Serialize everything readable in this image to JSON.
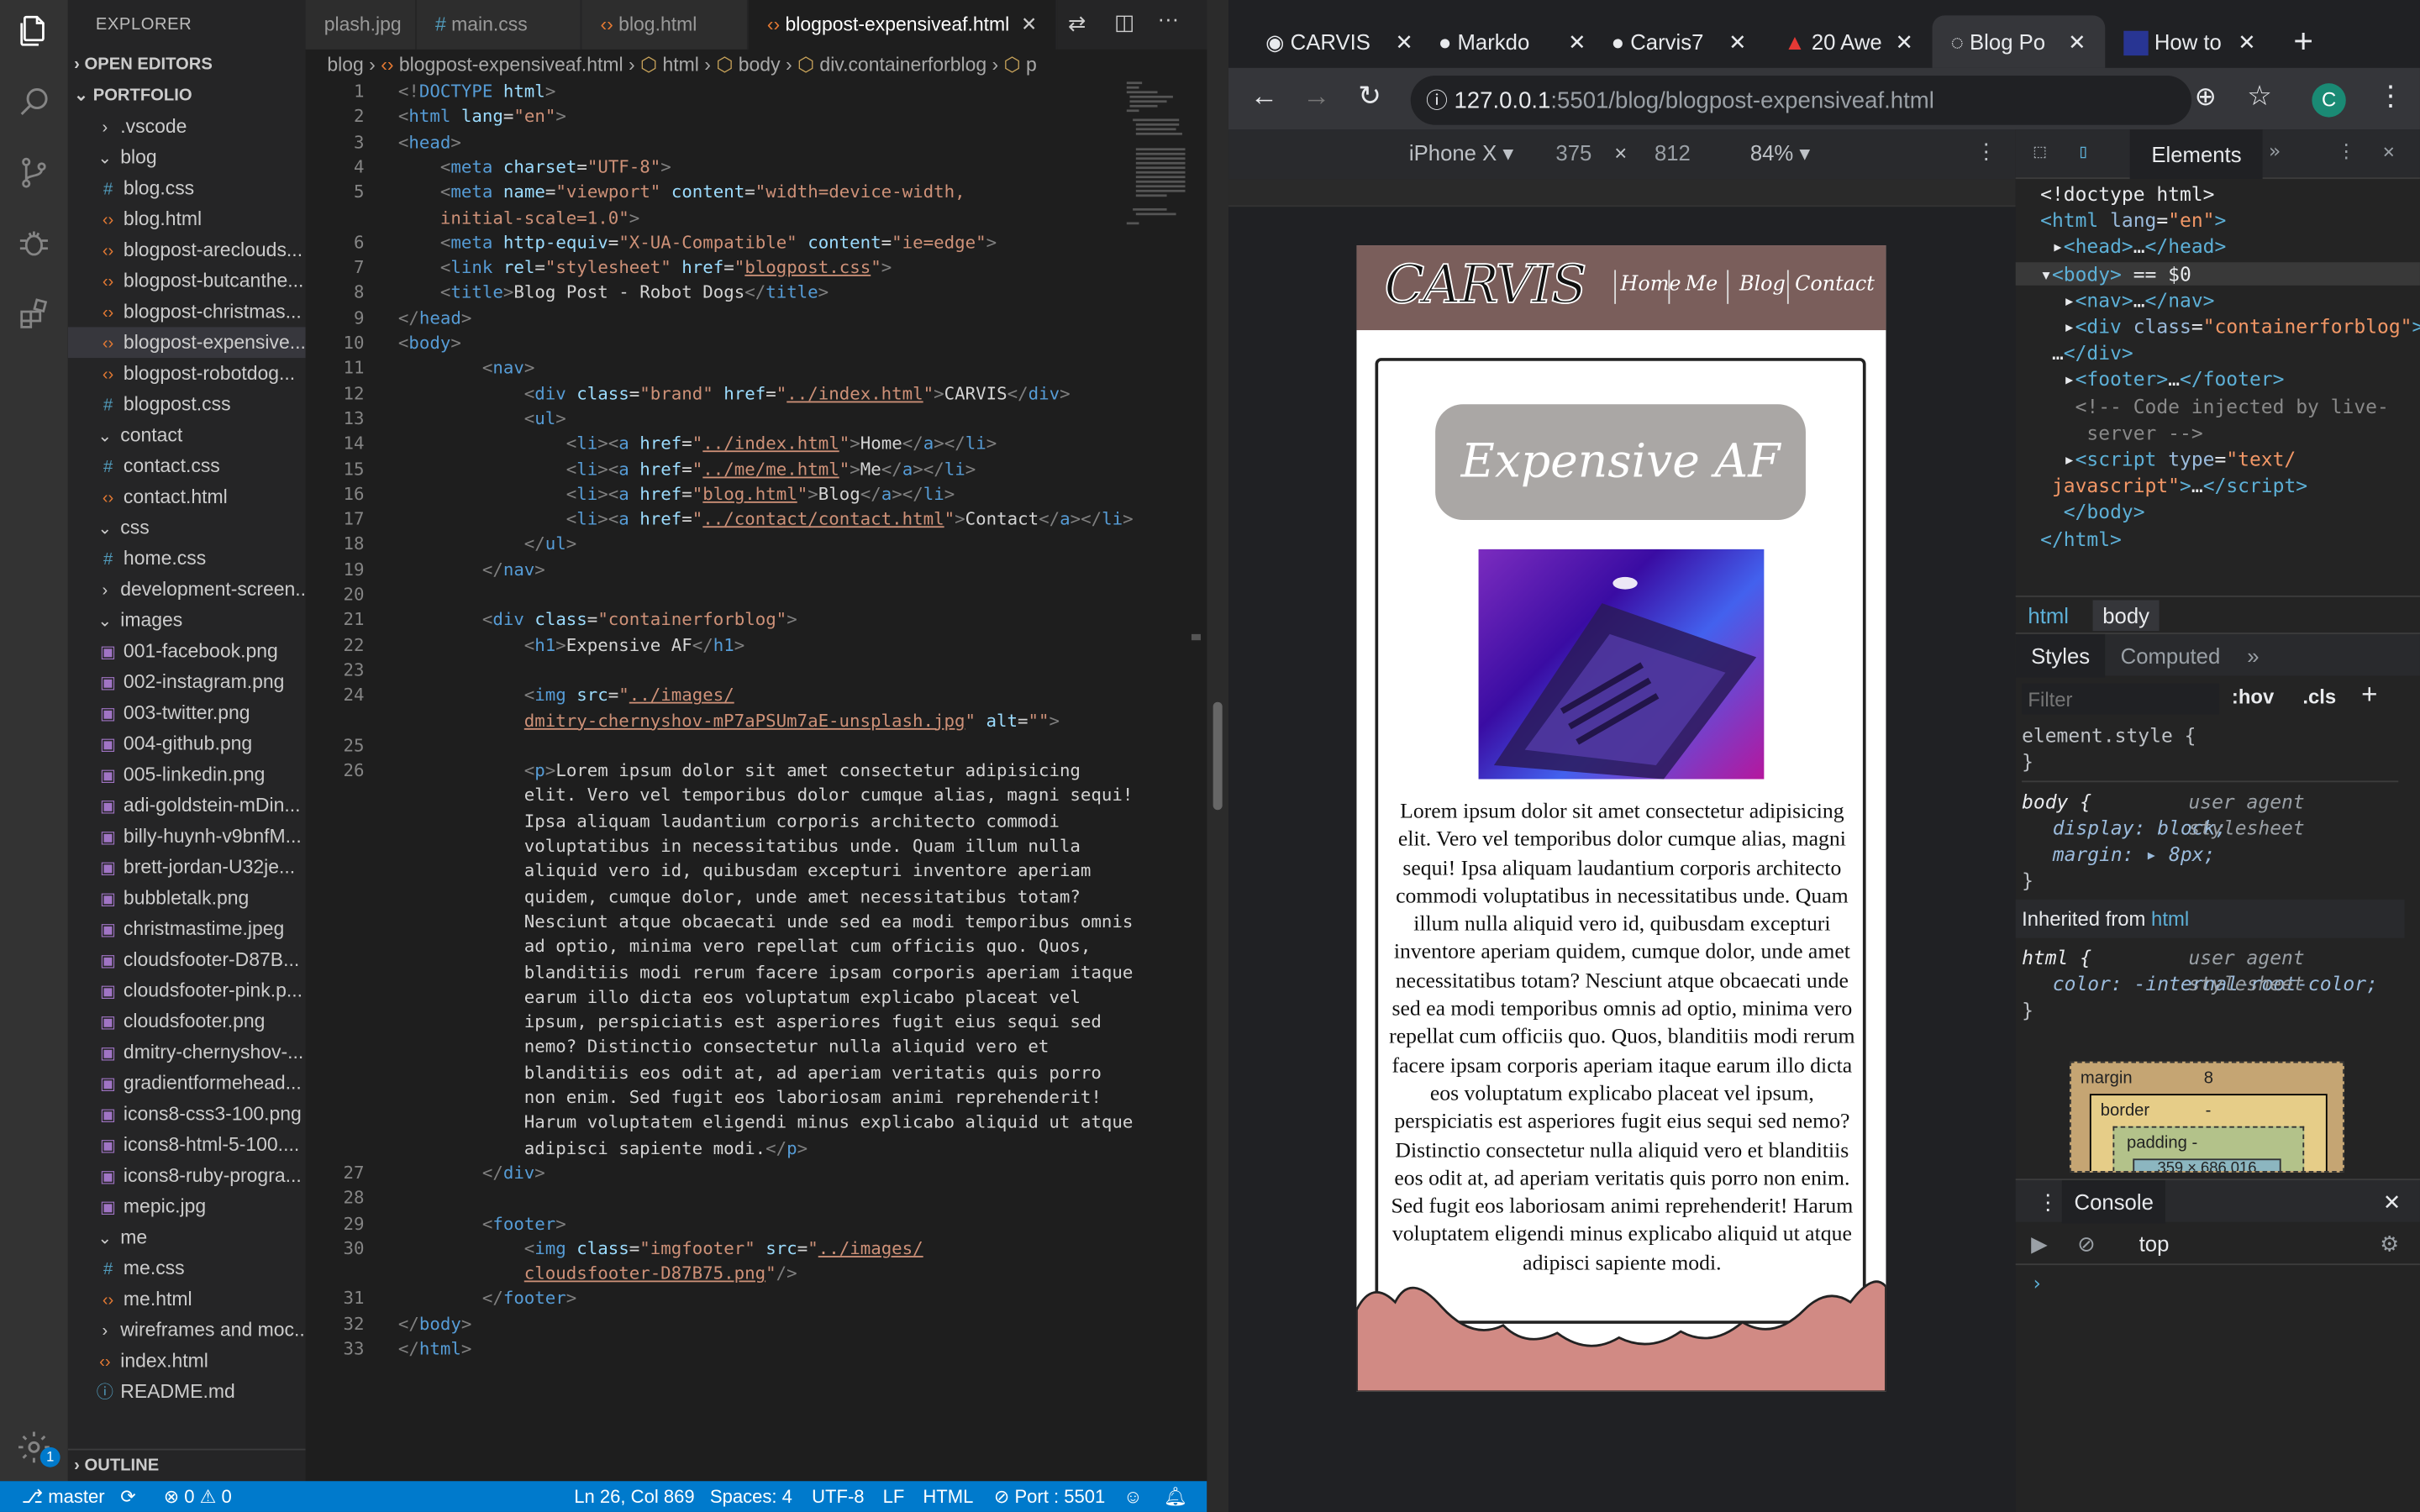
{
  "vscode": {
    "explorer_title": "EXPLORER",
    "sections": {
      "open_editors": "OPEN EDITORS",
      "portfolio": "PORTFOLIO",
      "outline": "OUTLINE"
    },
    "tree": [
      {
        "label": ".vscode",
        "type": "folder-closed",
        "indent": 1
      },
      {
        "label": "blog",
        "type": "folder-open",
        "indent": 1
      },
      {
        "label": "blog.css",
        "type": "css",
        "indent": 2
      },
      {
        "label": "blog.html",
        "type": "html",
        "indent": 2
      },
      {
        "label": "blogpost-areclouds...",
        "type": "html",
        "indent": 2
      },
      {
        "label": "blogpost-butcanthe...",
        "type": "html",
        "indent": 2
      },
      {
        "label": "blogpost-christmas...",
        "type": "html",
        "indent": 2
      },
      {
        "label": "blogpost-expensive...",
        "type": "html",
        "indent": 2,
        "selected": true
      },
      {
        "label": "blogpost-robotdog...",
        "type": "html",
        "indent": 2
      },
      {
        "label": "blogpost.css",
        "type": "css",
        "indent": 2
      },
      {
        "label": "contact",
        "type": "folder-open",
        "indent": 1
      },
      {
        "label": "contact.css",
        "type": "css",
        "indent": 2
      },
      {
        "label": "contact.html",
        "type": "html",
        "indent": 2
      },
      {
        "label": "css",
        "type": "folder-open",
        "indent": 1
      },
      {
        "label": "home.css",
        "type": "css",
        "indent": 2
      },
      {
        "label": "development-screen...",
        "type": "folder-closed",
        "indent": 1
      },
      {
        "label": "images",
        "type": "folder-open",
        "indent": 1
      },
      {
        "label": "001-facebook.png",
        "type": "img",
        "indent": 2
      },
      {
        "label": "002-instagram.png",
        "type": "img",
        "indent": 2
      },
      {
        "label": "003-twitter.png",
        "type": "img",
        "indent": 2
      },
      {
        "label": "004-github.png",
        "type": "img",
        "indent": 2
      },
      {
        "label": "005-linkedin.png",
        "type": "img",
        "indent": 2
      },
      {
        "label": "adi-goldstein-mDin...",
        "type": "img",
        "indent": 2
      },
      {
        "label": "billy-huynh-v9bnfM...",
        "type": "img",
        "indent": 2
      },
      {
        "label": "brett-jordan-U32je...",
        "type": "img",
        "indent": 2
      },
      {
        "label": "bubbletalk.png",
        "type": "img",
        "indent": 2
      },
      {
        "label": "christmastime.jpeg",
        "type": "img",
        "indent": 2
      },
      {
        "label": "cloudsfooter-D87B...",
        "type": "img",
        "indent": 2
      },
      {
        "label": "cloudsfooter-pink.p...",
        "type": "img",
        "indent": 2
      },
      {
        "label": "cloudsfooter.png",
        "type": "img",
        "indent": 2
      },
      {
        "label": "dmitry-chernyshov-...",
        "type": "img",
        "indent": 2
      },
      {
        "label": "gradientformehead...",
        "type": "img",
        "indent": 2
      },
      {
        "label": "icons8-css3-100.png",
        "type": "img",
        "indent": 2
      },
      {
        "label": "icons8-html-5-100....",
        "type": "img",
        "indent": 2
      },
      {
        "label": "icons8-ruby-progra...",
        "type": "img",
        "indent": 2
      },
      {
        "label": "mepic.jpg",
        "type": "img",
        "indent": 2
      },
      {
        "label": "me",
        "type": "folder-open",
        "indent": 1
      },
      {
        "label": "me.css",
        "type": "css",
        "indent": 2
      },
      {
        "label": "me.html",
        "type": "html",
        "indent": 2
      },
      {
        "label": "wireframes and moc...",
        "type": "folder-closed",
        "indent": 1
      },
      {
        "label": "index.html",
        "type": "html",
        "indent": 1
      },
      {
        "label": "README.md",
        "type": "md",
        "indent": 1
      }
    ],
    "tabs": [
      {
        "label": "plash.jpg",
        "icon": "img"
      },
      {
        "label": "main.css",
        "icon": "#"
      },
      {
        "label": "blog.html",
        "icon": "<>"
      },
      {
        "label": "blogpost-expensiveaf.html",
        "icon": "<>",
        "active": true
      }
    ],
    "breadcrumb": [
      "blog",
      "blogpost-expensiveaf.html",
      "html",
      "body",
      "div.containerforblog",
      "p"
    ],
    "code": [
      {
        "n": "1",
        "html": "<span class='pu'>&lt;!</span><span class='tg'>DOCTYPE</span> <span class='at'>html</span><span class='pu'>&gt;</span>"
      },
      {
        "n": "2",
        "html": "<span class='pu'>&lt;</span><span class='tg'>html</span> <span class='at'>lang</span>=<span class='st'>\"en\"</span><span class='pu'>&gt;</span>"
      },
      {
        "n": "3",
        "html": "<span class='pu'>&lt;</span><span class='tg'>head</span><span class='pu'>&gt;</span>"
      },
      {
        "n": "4",
        "html": "    <span class='pu'>&lt;</span><span class='tg'>meta</span> <span class='at'>charset</span>=<span class='st'>\"UTF-8\"</span><span class='pu'>&gt;</span>"
      },
      {
        "n": "5",
        "html": "    <span class='pu'>&lt;</span><span class='tg'>meta</span> <span class='at'>name</span>=<span class='st'>\"viewport\"</span> <span class='at'>content</span>=<span class='st'>\"width=device-width,</span>"
      },
      {
        "n": "",
        "html": "    <span class='st'>initial-scale=1.0\"</span><span class='pu'>&gt;</span>"
      },
      {
        "n": "6",
        "html": "    <span class='pu'>&lt;</span><span class='tg'>meta</span> <span class='at'>http-equiv</span>=<span class='st'>\"X-UA-Compatible\"</span> <span class='at'>content</span>=<span class='st'>\"ie=edge\"</span><span class='pu'>&gt;</span>"
      },
      {
        "n": "7",
        "html": "    <span class='pu'>&lt;</span><span class='tg'>link</span> <span class='at'>rel</span>=<span class='st'>\"stylesheet\"</span> <span class='at'>href</span>=<span class='st'>\"<span class='ul'>blogpost.css</span>\"</span><span class='pu'>&gt;</span>"
      },
      {
        "n": "8",
        "html": "    <span class='pu'>&lt;</span><span class='tg'>title</span><span class='pu'>&gt;</span>Blog Post - Robot Dogs<span class='pu'>&lt;/</span><span class='tg'>title</span><span class='pu'>&gt;</span>"
      },
      {
        "n": "9",
        "html": "<span class='pu'>&lt;/</span><span class='tg'>head</span><span class='pu'>&gt;</span>"
      },
      {
        "n": "10",
        "html": "<span class='pu'>&lt;</span><span class='tg'>body</span><span class='pu'>&gt;</span>"
      },
      {
        "n": "11",
        "html": "        <span class='pu'>&lt;</span><span class='tg'>nav</span><span class='pu'>&gt;</span>"
      },
      {
        "n": "12",
        "html": "            <span class='pu'>&lt;</span><span class='tg'>div</span> <span class='at'>class</span>=<span class='st'>\"brand\"</span> <span class='at'>href</span>=<span class='st'>\"<span class='ul'>../index.html</span>\"</span><span class='pu'>&gt;</span>CARVIS<span class='pu'>&lt;/</span><span class='tg'>div</span><span class='pu'>&gt;</span>"
      },
      {
        "n": "13",
        "html": "            <span class='pu'>&lt;</span><span class='tg'>ul</span><span class='pu'>&gt;</span>"
      },
      {
        "n": "14",
        "html": "                <span class='pu'>&lt;</span><span class='tg'>li</span><span class='pu'>&gt;&lt;</span><span class='tg'>a</span> <span class='at'>href</span>=<span class='st'>\"<span class='ul'>../index.html</span>\"</span><span class='pu'>&gt;</span>Home<span class='pu'>&lt;/</span><span class='tg'>a</span><span class='pu'>&gt;&lt;/</span><span class='tg'>li</span><span class='pu'>&gt;</span>"
      },
      {
        "n": "15",
        "html": "                <span class='pu'>&lt;</span><span class='tg'>li</span><span class='pu'>&gt;&lt;</span><span class='tg'>a</span> <span class='at'>href</span>=<span class='st'>\"<span class='ul'>../me/me.html</span>\"</span><span class='pu'>&gt;</span>Me<span class='pu'>&lt;/</span><span class='tg'>a</span><span class='pu'>&gt;&lt;/</span><span class='tg'>li</span><span class='pu'>&gt;</span>"
      },
      {
        "n": "16",
        "html": "                <span class='pu'>&lt;</span><span class='tg'>li</span><span class='pu'>&gt;&lt;</span><span class='tg'>a</span> <span class='at'>href</span>=<span class='st'>\"<span class='ul'>blog.html</span>\"</span><span class='pu'>&gt;</span>Blog<span class='pu'>&lt;/</span><span class='tg'>a</span><span class='pu'>&gt;&lt;/</span><span class='tg'>li</span><span class='pu'>&gt;</span>"
      },
      {
        "n": "17",
        "html": "                <span class='pu'>&lt;</span><span class='tg'>li</span><span class='pu'>&gt;&lt;</span><span class='tg'>a</span> <span class='at'>href</span>=<span class='st'>\"<span class='ul'>../contact/contact.html</span>\"</span><span class='pu'>&gt;</span>Contact<span class='pu'>&lt;/</span><span class='tg'>a</span><span class='pu'>&gt;&lt;/</span><span class='tg'>li</span><span class='pu'>&gt;</span>"
      },
      {
        "n": "18",
        "html": "            <span class='pu'>&lt;/</span><span class='tg'>ul</span><span class='pu'>&gt;</span>"
      },
      {
        "n": "19",
        "html": "        <span class='pu'>&lt;/</span><span class='tg'>nav</span><span class='pu'>&gt;</span>"
      },
      {
        "n": "20",
        "html": ""
      },
      {
        "n": "21",
        "html": "        <span class='pu'>&lt;</span><span class='tg'>div</span> <span class='at'>class</span>=<span class='st'>\"containerforblog\"</span><span class='pu'>&gt;</span>"
      },
      {
        "n": "22",
        "html": "            <span class='pu'>&lt;</span><span class='tg'>h1</span><span class='pu'>&gt;</span>Expensive AF<span class='pu'>&lt;/</span><span class='tg'>h1</span><span class='pu'>&gt;</span>"
      },
      {
        "n": "23",
        "html": ""
      },
      {
        "n": "24",
        "html": "            <span class='pu'>&lt;</span><span class='tg'>img</span> <span class='at'>src</span>=<span class='st'>\"<span class='ul'>../images/</span></span>"
      },
      {
        "n": "",
        "html": "            <span class='st'><span class='ul'>dmitry-chernyshov-mP7aPSUm7aE-unsplash.jpg</span>\"</span> <span class='at'>alt</span>=<span class='st'>\"\"</span><span class='pu'>&gt;</span>"
      },
      {
        "n": "25",
        "html": ""
      },
      {
        "n": "26",
        "html": "            <span class='pu'>&lt;</span><span class='tg'>p</span><span class='pu'>&gt;</span>Lorem ipsum dolor sit amet consectetur adipisicing"
      },
      {
        "n": "",
        "html": "            elit. Vero vel temporibus dolor cumque alias, magni sequi!"
      },
      {
        "n": "",
        "html": "            Ipsa aliquam laudantium corporis architecto commodi"
      },
      {
        "n": "",
        "html": "            voluptatibus in necessitatibus unde. Quam illum nulla"
      },
      {
        "n": "",
        "html": "            aliquid vero id, quibusdam excepturi inventore aperiam"
      },
      {
        "n": "",
        "html": "            quidem, cumque dolor, unde amet necessitatibus totam?"
      },
      {
        "n": "",
        "html": "            Nesciunt atque obcaecati unde sed ea modi temporibus omnis"
      },
      {
        "n": "",
        "html": "            ad optio, minima vero repellat cum officiis quo. Quos,"
      },
      {
        "n": "",
        "html": "            blanditiis modi rerum facere ipsam corporis aperiam itaque"
      },
      {
        "n": "",
        "html": "            earum illo dicta eos voluptatum explicabo placeat vel"
      },
      {
        "n": "",
        "html": "            ipsum, perspiciatis est asperiores fugit eius sequi sed"
      },
      {
        "n": "",
        "html": "            nemo? Distinctio consectetur nulla aliquid vero et"
      },
      {
        "n": "",
        "html": "            blanditiis eos odit at, ad aperiam veritatis quis porro"
      },
      {
        "n": "",
        "html": "            non enim. Sed fugit eos laboriosam animi reprehenderit!"
      },
      {
        "n": "",
        "html": "            Harum voluptatem eligendi minus explicabo aliquid ut atque"
      },
      {
        "n": "",
        "html": "            adipisci sapiente modi.<span class='pu'>&lt;/</span><span class='tg'>p</span><span class='pu'>&gt;</span>"
      },
      {
        "n": "27",
        "html": "        <span class='pu'>&lt;/</span><span class='tg'>div</span><span class='pu'>&gt;</span>"
      },
      {
        "n": "28",
        "html": ""
      },
      {
        "n": "29",
        "html": "        <span class='pu'>&lt;</span><span class='tg'>footer</span><span class='pu'>&gt;</span>"
      },
      {
        "n": "30",
        "html": "            <span class='pu'>&lt;</span><span class='tg'>img</span> <span class='at'>class</span>=<span class='st'>\"imgfooter\"</span> <span class='at'>src</span>=<span class='st'>\"<span class='ul'>../images/</span></span>"
      },
      {
        "n": "",
        "html": "            <span class='st'><span class='ul'>cloudsfooter-D87B75.png</span>\"</span><span class='pu'>/&gt;</span>"
      },
      {
        "n": "31",
        "html": "        <span class='pu'>&lt;/</span><span class='tg'>footer</span><span class='pu'>&gt;</span>"
      },
      {
        "n": "32",
        "html": "<span class='pu'>&lt;/</span><span class='tg'>body</span><span class='pu'>&gt;</span>"
      },
      {
        "n": "33",
        "html": "<span class='pu'>&lt;/</span><span class='tg'>html</span><span class='pu'>&gt;</span>"
      }
    ],
    "status": {
      "branch": "master",
      "problems": "⊗ 0 ⚠ 0",
      "position": "Ln 26, Col 869",
      "spaces": "Spaces: 4",
      "encoding": "UTF-8",
      "eol": "LF",
      "language": "HTML",
      "port": "Port : 5501",
      "badge": "1"
    }
  },
  "chrome": {
    "tabs": [
      {
        "label": "CARVIS"
      },
      {
        "label": "Markdo"
      },
      {
        "label": "Carvis7"
      },
      {
        "label": "20 Awe"
      },
      {
        "label": "Blog Po",
        "active": true
      },
      {
        "label": "How to"
      }
    ],
    "url_host": "127.0.0.1",
    "url_path": ":5501/blog/blogpost-expensiveaf.html",
    "profile_letter": "C",
    "device": {
      "name": "iPhone X ▾",
      "width": "375",
      "height": "812",
      "zoom": "84% ▾"
    }
  },
  "page": {
    "brand": "CARVIS",
    "nav": [
      "Home",
      "Me",
      "Blog",
      "Contact"
    ],
    "heading": "Expensive AF",
    "body": "Lorem ipsum dolor sit amet consectetur adipisicing elit. Vero vel temporibus dolor cumque alias, magni sequi! Ipsa aliquam laudantium corporis architecto commodi voluptatibus in necessitatibus unde. Quam illum nulla aliquid vero id, quibusdam excepturi inventore aperiam quidem, cumque dolor, unde amet necessitatibus totam? Nesciunt atque obcaecati unde sed ea modi temporibus omnis ad optio, minima vero repellat cum officiis quo. Quos, blanditiis modi rerum facere ipsam corporis aperiam itaque earum illo dicta eos voluptatum explicabo placeat vel ipsum, perspiciatis est asperiores fugit eius sequi sed nemo? Distinctio consectetur nulla aliquid vero et blanditiis eos odit at, ad aperiam veritatis quis porro non enim. Sed fugit eos laboriosam animi reprehenderit! Harum voluptatem eligendi minus explicabo aliquid ut atque adipisci sapiente modi."
  },
  "devtools": {
    "tab_elements": "Elements",
    "dom": [
      {
        "html": "&lt;!doctype html&gt;"
      },
      {
        "html": "<span class='dtag'>&lt;html</span> <span class='datt'>lang</span>=<span class='dstr'>\"en\"</span><span class='dtag'>&gt;</span>"
      },
      {
        "html": "&nbsp;▸<span class='dtag'>&lt;head&gt;</span>…<span class='dtag'>&lt;/head&gt;</span>"
      },
      {
        "html": "▾<span class='dtag'>&lt;body&gt;</span> == $0",
        "selected": true
      },
      {
        "html": "&nbsp;&nbsp;▸<span class='dtag'>&lt;nav&gt;</span>…<span class='dtag'>&lt;/nav&gt;</span>"
      },
      {
        "html": "&nbsp;&nbsp;▸<span class='dtag'>&lt;div</span> <span class='datt'>class</span>=<span class='dstr'>\"containerforblog\"</span><span class='dtag'>&gt;</span>"
      },
      {
        "html": "&nbsp;…<span class='dtag'>&lt;/div&gt;</span>"
      },
      {
        "html": "&nbsp;&nbsp;▸<span class='dtag'>&lt;footer&gt;</span>…<span class='dtag'>&lt;/footer&gt;</span>"
      },
      {
        "html": "&nbsp;&nbsp;&nbsp;<span class='dcom'>&lt;!-- Code injected by live-</span>"
      },
      {
        "html": "&nbsp;&nbsp;&nbsp;&nbsp;<span class='dcom'>server --&gt;</span>"
      },
      {
        "html": "&nbsp;&nbsp;▸<span class='dtag'>&lt;script</span> <span class='datt'>type</span>=<span class='dstr'>\"text/</span>"
      },
      {
        "html": "&nbsp;<span class='dstr'>javascript\"</span><span class='dtag'>&gt;</span>…<span class='dtag'>&lt;/script&gt;</span>"
      },
      {
        "html": "&nbsp;&nbsp;<span class='dtag'>&lt;/body&gt;</span>"
      },
      {
        "html": "<span class='dtag'>&lt;/html&gt;</span>"
      }
    ],
    "crumbs": [
      "html",
      "body"
    ],
    "styles_tabs": [
      "Styles",
      "Computed"
    ],
    "filter_placeholder": "Filter",
    "hov": ":hov",
    "cls": ".cls",
    "element_style": "element.style {",
    "close_brace": "}",
    "body_rule": "body {",
    "ua": "user agent stylesheet",
    "display": "display: block;",
    "margin": "margin: ▸ 8px;",
    "inherited": "Inherited from",
    "inherited_tag": "html",
    "html_rule": "html {",
    "color_prop": "color: -internal-root-color;",
    "box": {
      "margin_label": "margin",
      "margin_val": "8",
      "border_label": "border",
      "border_val": "-",
      "padding_label": "padding -",
      "content": "359 × 686.016"
    },
    "console_tab": "Console",
    "console_context": "top"
  }
}
